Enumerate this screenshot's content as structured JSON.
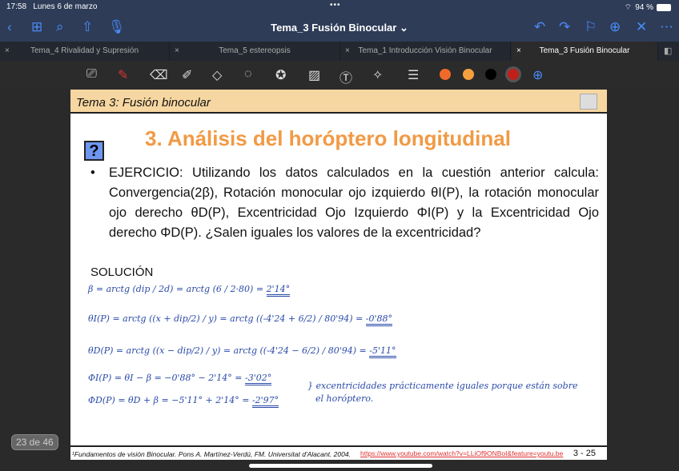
{
  "status": {
    "time": "17:58",
    "date": "Lunes 6 de marzo",
    "battery": "94 %",
    "battery_level": 94
  },
  "nav": {
    "title": "Tema_3 Fusión Binocular",
    "icons": [
      "back-icon",
      "grid-icon",
      "search-icon",
      "share-icon",
      "microphone-icon",
      "undo-icon",
      "redo-icon",
      "bookmark-icon",
      "add-page-icon",
      "close-icon",
      "more-icon"
    ]
  },
  "tabs": [
    {
      "label": "Tema_4 Rivalidad y Supresión",
      "close": "×"
    },
    {
      "label": "Tema_5 estereopsis",
      "close": "×"
    },
    {
      "label": "Tema_1 Introducción Visión Binocular",
      "close": "×"
    },
    {
      "label": "Tema_3 Fusión Binocular",
      "close": "×",
      "active": true
    }
  ],
  "toolbar": {
    "colors": [
      "#f06a2a",
      "#f5a040",
      "#000000",
      "#c0201a"
    ],
    "selected_color": "#c0201a"
  },
  "slide": {
    "header": "Tema 3: Fusión binocular",
    "title": "3. Análisis del horóptero longitudinal",
    "help_icon": "?",
    "bullet": "•",
    "exercise": "EJERCICIO: Utilizando los datos calculados en la cuestión anterior calcula: Convergencia(2β),  Rotación monocular ojo izquierdo θI(P),  la rotación monocular ojo derecho θD(P), Excentricidad Ojo Izquierdo ΦI(P) y la Excentricidad Ojo derecho ΦD(P). ¿Salen iguales los valores de la excentricidad?",
    "solution_label": "SOLUCIÓN",
    "handwriting": {
      "l1": "β = arctg (dip / 2d) = arctg (6 / 2·80) =",
      "r1": "2'14°",
      "l2": "θI(P) = arctg ((x + dip/2) / y) = arctg ((-4'24 + 6/2) / 80'94) =",
      "r2": "-0'88°",
      "l3": "θD(P) = arctg ((x − dip/2) / y) = arctg ((-4'24 − 6/2) / 80'94) =",
      "r3": "-5'11°",
      "l4": "ΦI(P) = θI − β = −0'88° − 2'14° =",
      "r4": "-3'02°",
      "l5": "ΦD(P) = θD + β = −5'11° + 2'14° =",
      "r5": "-2'97°",
      "note1": "} excentricidades prácticamente iguales porque están sobre",
      "note2": "el horóptero."
    },
    "footer_citation": "¹Fundamentos de visión Binocular. Pons A. Martínez-Verdú, FM. Universitat d'Alacant. 2004.",
    "footer_url": "https://www.youtube.com/watch?v=LLiOf9ONBoI&feature=youtu.be",
    "page_label": "3 - 25"
  },
  "page_counter": "23 de 46"
}
